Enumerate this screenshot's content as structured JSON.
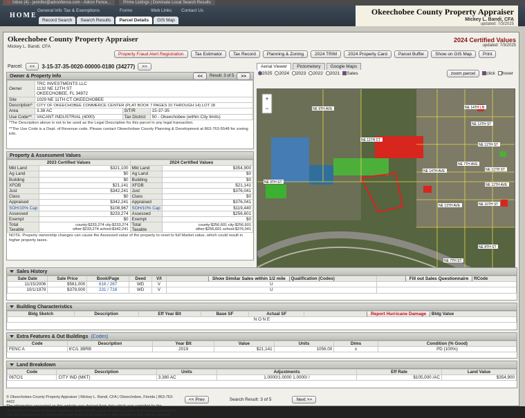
{
  "browser": {
    "tabs": [
      "Inbox (4) - jennifer@adronfence.com - Adron Fence...",
      "Prime Listings | Dominate Local Search Results"
    ]
  },
  "nav": {
    "home": "HOME",
    "links": [
      "General Info",
      "Tax & Exemptions",
      "Forms",
      "Web Links",
      "Contact Us"
    ],
    "subtabs": [
      "Record Search",
      "Search Results",
      "Parcel Details",
      "GIS Map"
    ]
  },
  "site": {
    "title": "Okeechobee County Property Appraiser",
    "appraiser": "Mickey L. Bandi, CFA",
    "updated": "updated: 7/3/2025"
  },
  "header": {
    "title": "Okeechobee County Property Appraiser",
    "sub": "Mickey L. Bandi, CFA"
  },
  "certified": {
    "title": "2024 Certified Values",
    "updated": "updated: 7/3/2025"
  },
  "buttons": [
    "Property Fraud Alert Registration",
    "Tax Estimator",
    "Tax Record",
    "Planning & Zoning",
    "2024 TRIM",
    "2024 Property Card",
    "Parcel Buffer",
    "Show on GIS Map",
    "Print"
  ],
  "parcel": {
    "label": "Parcel:",
    "number": "3-15-37-35-0020-00000-0180 (34277)"
  },
  "owner": {
    "heading": "Owner & Property Info",
    "result": "Result: 3 of 5",
    "rows": [
      [
        "Owner",
        "TRC INVESTMENTS LLC\n1132 NE 12TH ST\nOKEECHOBEE, FL 34972"
      ],
      [
        "Site",
        "1029 NE 11TH CT OKEECHOBEE"
      ],
      [
        "Description*",
        "CITY OF OKEECHOBEE COMMERCE CENTER (PLAT BOOK 7 PAGES 10 THROUGH 14) LOT 18"
      ]
    ],
    "area": "3.38 AC",
    "str_label": "S/T/R",
    "str": "15-37-35",
    "usecode": "VACANT INDUSTRIAL (4000)",
    "taxdist_label": "Tax District",
    "taxdist": "50 - Okeechobee (within City limits)",
    "note1": "*The Description above is not to be used as the Legal Description for this parcel in any legal transaction.",
    "note2": "**The Use Code is a Dept. of Revenue code. Please contact Okeechobee County Planning & Development at 863-763-5548 for zoning info."
  },
  "values": {
    "heading": "Property & Assessment Values",
    "col2023": "2023 Certified Values",
    "col2024": "2024 Certified Values",
    "rows": [
      [
        "Mkt Land",
        "$321,100",
        "Mkt Land",
        "$354,900"
      ],
      [
        "Ag Land",
        "$0",
        "Ag Land",
        "$0"
      ],
      [
        "Building",
        "$0",
        "Building",
        "$0"
      ],
      [
        "XFOB",
        "$21,141",
        "XFOB",
        "$21,141"
      ],
      [
        "Just",
        "$342,241",
        "Just",
        "$376,041"
      ],
      [
        "Class",
        "$0",
        "Class",
        "$0"
      ],
      [
        "Appraised",
        "$342,241",
        "Appraised",
        "$376,041"
      ],
      [
        "SOH/10% Cap",
        "$108,967",
        "SOH/10% Cap",
        "$119,440"
      ],
      [
        "Assessed",
        "$233,274",
        "Assessed",
        "$256,601"
      ],
      [
        "Exempt",
        "$0",
        "Exempt",
        "$0"
      ]
    ],
    "total23a": "county:$233,274 city:$233,274",
    "total23b": "other:$233,274 school:$342,241",
    "total24a": "county:$256,601 city:$256,601",
    "total24b": "other:$256,601 school:$376,041",
    "note": "NOTE: Property ownership changes can cause the Assessed value of the property to reset to full Market value, which could result in higher property taxes."
  },
  "map": {
    "tabs": [
      "Aerial Viewer",
      "Pictometery",
      "Google Maps"
    ],
    "years": [
      "2025",
      "2024",
      "2023",
      "2022",
      "2021"
    ],
    "sales": "Sales",
    "zoom": "zoom parcel",
    "click": "click",
    "hover": "hover",
    "streets": [
      "NE 14TH LN",
      "NE 13TH ST",
      "NE 12TH ST",
      "NE 11TH ST",
      "NE 10TH ST",
      "NE 9TH ST",
      "NE 8TH ST",
      "NE 7TH ST",
      "NE 6TH ST",
      "NE 5TH ST",
      "NE 11TH CT",
      "NE 9TH AVE",
      "NE 12TH AVE",
      "NE 13TH AVE",
      "NE 14TH AVE",
      "NE 7TH AVE"
    ]
  },
  "sales": {
    "heading": "Sales History",
    "similar": "Show Similar Sales within 1/2 mile",
    "fillout": "Fill out Sales Questionnaire",
    "cols": [
      "Sale Date",
      "Sale Price",
      "Book/Page",
      "Deed",
      "V/I",
      "Qualification (Codes)",
      "RCode"
    ],
    "rows": [
      [
        "11/15/2006",
        "$561,000",
        "616 / 267",
        "WD",
        "V",
        "U",
        ""
      ],
      [
        "10/1/1979",
        "$379,000",
        "231 / 716",
        "WD",
        "V",
        "U",
        ""
      ]
    ]
  },
  "building": {
    "heading": "Building Characteristics",
    "sketch": "Bldg Sketch",
    "cols": [
      "Description",
      "Eff Year Blt",
      "Base SF",
      "Actual SF",
      "Bldg Value"
    ],
    "none": "N O N E",
    "hurricane": "Report Hurricane Damage"
  },
  "extra": {
    "heading": "Extra Features & Out Buildings",
    "codes": "(Codes)",
    "cols": [
      "Code",
      "Description",
      "Year Blt",
      "Value",
      "Units",
      "Dims",
      "Condition (% Good)"
    ],
    "row": [
      "FENC A",
      "6'C/L 3BRB",
      "2019",
      "$21,141",
      "1056.00",
      "x",
      "PD (100%)"
    ]
  },
  "land": {
    "heading": "Land Breakdown",
    "cols": [
      "Code",
      "Description",
      "Units",
      "Adjustments",
      "Eff Rate",
      "Land Value"
    ],
    "row": [
      "067CI1",
      "CITY IND (MKT)",
      "3.380 AC",
      "1.0000/1.0000 1.0000/ /",
      "$105,000 /AC",
      "$354,900"
    ]
  },
  "footer": {
    "line1": "© Okeechobee County Property Appraiser | Mickey L. Bandi, CFA | Okeechobee, Florida | 863-763-4422",
    "line2": "The information presented on this website was derived from data which was compiled by the Okeechobee County Property Appraiser solely for the governmental purpose of property assessment. The GIS Map image is not a survey and shall not be used in a Title Search or any official capacity.",
    "prev": "<< Prev",
    "result": "Search Result: 3 of 5",
    "next": "Next >>"
  }
}
